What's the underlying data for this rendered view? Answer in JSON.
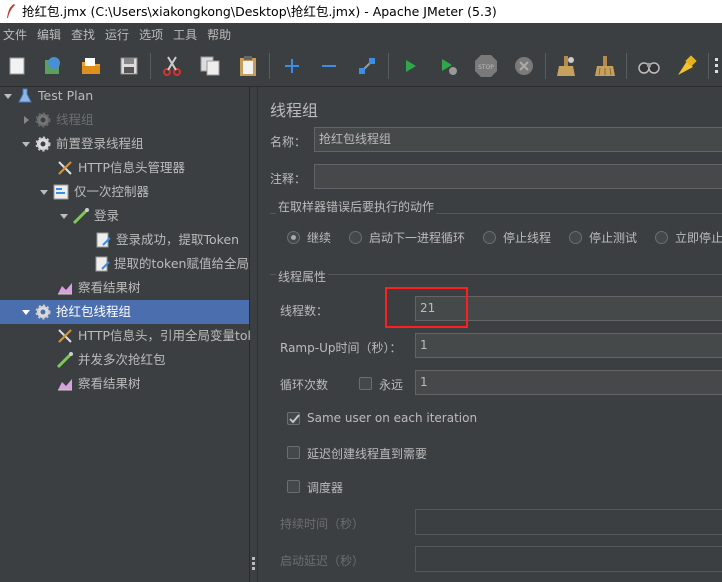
{
  "window": {
    "title": "抢红包.jmx (C:\\Users\\xiakongkong\\Desktop\\抢红包.jmx) - Apache JMeter (5.3)"
  },
  "menu": [
    "文件",
    "编辑",
    "查找",
    "运行",
    "选项",
    "工具",
    "帮助"
  ],
  "toolbar": {
    "icons": [
      "new-icon",
      "templates-icon",
      "open-icon",
      "save-icon",
      "cut-icon",
      "copy-icon",
      "paste-icon",
      "expand-icon",
      "collapse-icon",
      "toggle-icon",
      "start-icon",
      "start-no-pause-icon",
      "stop-icon",
      "shutdown-icon",
      "clear-icon",
      "clear-all-icon",
      "search-icon",
      "reset-search-icon"
    ]
  },
  "tree": {
    "nodes": [
      {
        "label": "Test Plan"
      },
      {
        "label": "线程组"
      },
      {
        "label": "前置登录线程组"
      },
      {
        "label": "HTTP信息头管理器"
      },
      {
        "label": "仅一次控制器"
      },
      {
        "label": "登录"
      },
      {
        "label": "登录成功，提取Token"
      },
      {
        "label": "提取的token赋值给全局变"
      },
      {
        "label": "察看结果树"
      },
      {
        "label": "抢红包线程组"
      },
      {
        "label": "HTTP信息头，引用全局变量toke"
      },
      {
        "label": "并发多次抢红包"
      },
      {
        "label": "察看结果树"
      }
    ]
  },
  "panel": {
    "heading": "线程组",
    "name_label": "名称：",
    "name_value": "抢红包线程组",
    "comment_label": "注释：",
    "comment_value": "",
    "error_action": {
      "title": "在取样器错误后要执行的动作",
      "options": [
        "继续",
        "启动下一进程循环",
        "停止线程",
        "停止测试",
        "立即停止"
      ],
      "selected": "继续"
    },
    "thread_props": {
      "title": "线程属性",
      "threads_label": "线程数：",
      "threads_value": "21",
      "rampup_label": "Ramp-Up时间（秒）：",
      "rampup_value": "1",
      "loop_label": "循环次数",
      "forever_label": "永远",
      "forever_checked": false,
      "loop_value": "1",
      "same_user_label": "Same user on each iteration",
      "same_user_checked": true,
      "delay_label": "延迟创建线程直到需要",
      "delay_checked": false,
      "scheduler_label": "调度器",
      "scheduler_checked": false,
      "duration_label": "持续时间（秒）",
      "duration_value": "",
      "startup_delay_label": "启动延迟（秒）",
      "startup_delay_value": ""
    }
  },
  "colors": {
    "background": "#3c3f41",
    "selection": "#4b6eaf",
    "highlight_box": "#ff1f1f"
  }
}
